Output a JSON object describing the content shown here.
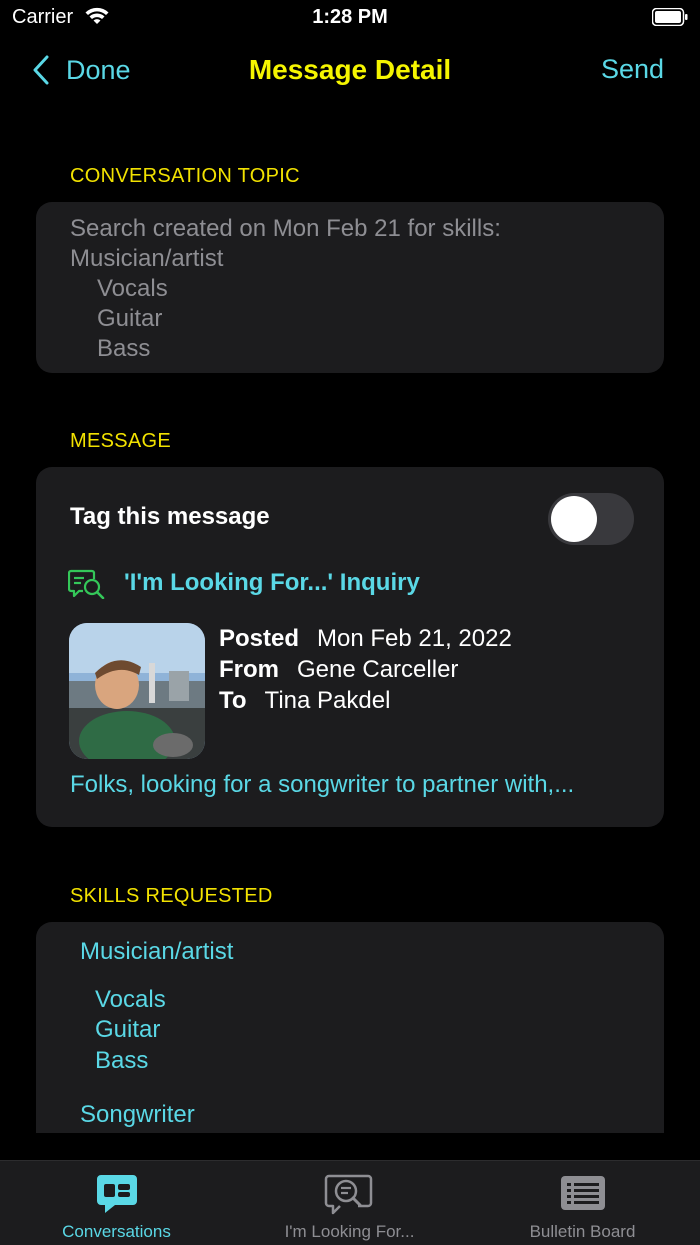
{
  "status_bar": {
    "carrier": "Carrier",
    "time": "1:28 PM"
  },
  "nav": {
    "back_label": "Done",
    "title": "Message Detail",
    "send_label": "Send"
  },
  "topic": {
    "header": "CONVERSATION TOPIC",
    "line1": "Search created on Mon Feb 21 for skills:",
    "line2": "Musician/artist",
    "skills": [
      "Vocals",
      "Guitar",
      "Bass"
    ]
  },
  "message": {
    "header": "MESSAGE",
    "tag_label": "Tag this message",
    "tag_on": false,
    "inquiry_title": "'I'm Looking For...' Inquiry",
    "posted_key": "Posted",
    "posted_value": "Mon Feb 21, 2022",
    "from_key": "From",
    "from_value": "Gene Carceller",
    "to_key": "To",
    "to_value": "Tina Pakdel",
    "preview": "Folks, looking for a songwriter to partner with,..."
  },
  "skills_requested": {
    "header": "SKILLS REQUESTED",
    "group1": "Musician/artist",
    "group1_items": [
      "Vocals",
      "Guitar",
      "Bass"
    ],
    "group2": "Songwriter"
  },
  "tabs": [
    {
      "label": "Conversations",
      "icon": "chat-bubble-icon",
      "active": true
    },
    {
      "label": "I'm Looking For...",
      "icon": "search-chat-icon",
      "active": false
    },
    {
      "label": "Bulletin Board",
      "icon": "bulletin-list-icon",
      "active": false
    }
  ],
  "colors": {
    "accent": "#5ad8e6",
    "title": "#f5f500",
    "section": "#f2e200",
    "card": "#1c1c1e",
    "inactive": "#8e8e93"
  }
}
